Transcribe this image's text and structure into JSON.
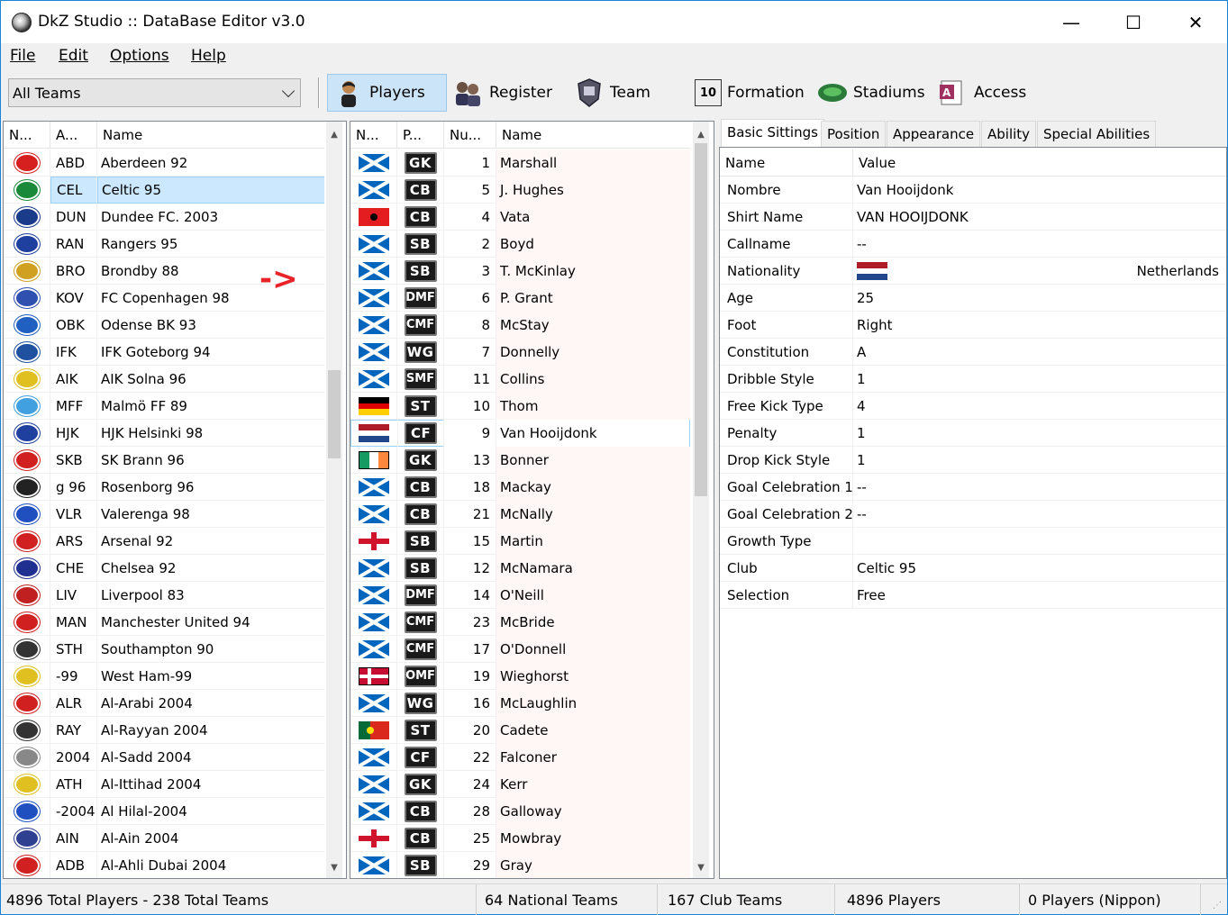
{
  "window": {
    "title": "DkZ Studio :: DataBase Editor v3.0",
    "min": "—",
    "max": "☐",
    "close": "✕"
  },
  "menu": [
    {
      "label": "File"
    },
    {
      "label": "Edit"
    },
    {
      "label": "Options"
    },
    {
      "label": "Help"
    }
  ],
  "team_filter": {
    "value": "All Teams"
  },
  "toolbar": {
    "players": "Players",
    "register": "Register",
    "team": "Team",
    "formation": "Formation",
    "stadiums": "Stadiums",
    "access": "Access"
  },
  "teams_table": {
    "headers": [
      "N...",
      "A...",
      "Name"
    ],
    "selected_index": 1,
    "rows": [
      {
        "abbr": "ABD",
        "name": "Aberdeen 92",
        "color": "#d62020"
      },
      {
        "abbr": "CEL",
        "name": "Celtic 95",
        "color": "#1a8a3a"
      },
      {
        "abbr": "DUN",
        "name": "Dundee FC. 2003",
        "color": "#1a3a8a"
      },
      {
        "abbr": "RAN",
        "name": "Rangers 95",
        "color": "#2040a0"
      },
      {
        "abbr": "BRO",
        "name": "Brondby 88",
        "color": "#d0a020"
      },
      {
        "abbr": "KOV",
        "name": "FC Copenhagen 98",
        "color": "#3050b0"
      },
      {
        "abbr": "OBK",
        "name": "Odense BK 93",
        "color": "#2060c0"
      },
      {
        "abbr": "IFK",
        "name": "IFK Goteborg 94",
        "color": "#2050a0"
      },
      {
        "abbr": "AIK",
        "name": "AIK Solna 96",
        "color": "#e0c020"
      },
      {
        "abbr": "MFF",
        "name": "Malmö FF 89",
        "color": "#40a0e0"
      },
      {
        "abbr": "HJK",
        "name": "HJK Helsinki 98",
        "color": "#2040a0"
      },
      {
        "abbr": "SKB",
        "name": "SK Brann 96",
        "color": "#d02020"
      },
      {
        "abbr": "g 96",
        "name": "Rosenborg 96",
        "color": "#222222"
      },
      {
        "abbr": "VLR",
        "name": "Valerenga 98",
        "color": "#2050c0"
      },
      {
        "abbr": "ARS",
        "name": "Arsenal 92",
        "color": "#d02020"
      },
      {
        "abbr": "CHE",
        "name": "Chelsea 92",
        "color": "#203090"
      },
      {
        "abbr": "LIV",
        "name": "Liverpool 83",
        "color": "#c02020"
      },
      {
        "abbr": "MAN",
        "name": "Manchester United 94",
        "color": "#d02020"
      },
      {
        "abbr": "STH",
        "name": "Southampton 90",
        "color": "#333333"
      },
      {
        "abbr": "-99",
        "name": "West Ham-99",
        "color": "#e0c020"
      },
      {
        "abbr": "ALR",
        "name": "Al-Arabi 2004",
        "color": "#d02020"
      },
      {
        "abbr": "RAY",
        "name": "Al-Rayyan 2004",
        "color": "#333333"
      },
      {
        "abbr": "2004",
        "name": "Al-Sadd 2004",
        "color": "#888888"
      },
      {
        "abbr": "ATH",
        "name": "Al-Ittihad 2004",
        "color": "#e0c020"
      },
      {
        "abbr": "-2004",
        "name": "Al Hilal-2004",
        "color": "#2050c0"
      },
      {
        "abbr": "AIN",
        "name": "Al-Ain 2004",
        "color": "#304090"
      },
      {
        "abbr": "ADB",
        "name": "Al-Ahli Dubai 2004",
        "color": "#d02020"
      }
    ]
  },
  "players_table": {
    "headers": [
      "N...",
      "P...",
      "Nu...",
      "Name"
    ],
    "selected_index": 10,
    "rows": [
      {
        "flag": "scotland",
        "pos": "GK",
        "num": "1",
        "name": "Marshall"
      },
      {
        "flag": "scotland",
        "pos": "CB",
        "num": "5",
        "name": "J. Hughes"
      },
      {
        "flag": "albania",
        "pos": "CB",
        "num": "4",
        "name": "Vata"
      },
      {
        "flag": "scotland",
        "pos": "SB",
        "num": "2",
        "name": "Boyd"
      },
      {
        "flag": "scotland",
        "pos": "SB",
        "num": "3",
        "name": "T. McKinlay"
      },
      {
        "flag": "scotland",
        "pos": "DMF",
        "num": "6",
        "name": "P. Grant"
      },
      {
        "flag": "scotland",
        "pos": "CMF",
        "num": "8",
        "name": "McStay"
      },
      {
        "flag": "scotland",
        "pos": "WG",
        "num": "7",
        "name": "Donnelly"
      },
      {
        "flag": "scotland",
        "pos": "SMF",
        "num": "11",
        "name": "Collins"
      },
      {
        "flag": "germany",
        "pos": "ST",
        "num": "10",
        "name": "Thom"
      },
      {
        "flag": "netherlands",
        "pos": "CF",
        "num": "9",
        "name": "Van Hooijdonk"
      },
      {
        "flag": "ireland",
        "pos": "GK",
        "num": "13",
        "name": "Bonner"
      },
      {
        "flag": "scotland",
        "pos": "CB",
        "num": "18",
        "name": "Mackay"
      },
      {
        "flag": "scotland",
        "pos": "CB",
        "num": "21",
        "name": "McNally"
      },
      {
        "flag": "england",
        "pos": "SB",
        "num": "15",
        "name": "Martin"
      },
      {
        "flag": "scotland",
        "pos": "SB",
        "num": "12",
        "name": "McNamara"
      },
      {
        "flag": "scotland",
        "pos": "DMF",
        "num": "14",
        "name": "O'Neill"
      },
      {
        "flag": "scotland",
        "pos": "CMF",
        "num": "23",
        "name": "McBride"
      },
      {
        "flag": "scotland",
        "pos": "CMF",
        "num": "17",
        "name": "O'Donnell"
      },
      {
        "flag": "denmark",
        "pos": "OMF",
        "num": "19",
        "name": "Wieghorst"
      },
      {
        "flag": "scotland",
        "pos": "WG",
        "num": "16",
        "name": "McLaughlin"
      },
      {
        "flag": "portugal",
        "pos": "ST",
        "num": "20",
        "name": "Cadete"
      },
      {
        "flag": "scotland",
        "pos": "CF",
        "num": "22",
        "name": "Falconer"
      },
      {
        "flag": "scotland",
        "pos": "GK",
        "num": "24",
        "name": "Kerr"
      },
      {
        "flag": "scotland",
        "pos": "CB",
        "num": "28",
        "name": "Galloway"
      },
      {
        "flag": "england",
        "pos": "CB",
        "num": "25",
        "name": "Mowbray"
      },
      {
        "flag": "scotland",
        "pos": "SB",
        "num": "29",
        "name": "Gray"
      }
    ]
  },
  "position_colors": {
    "GK": "#1a1a1a",
    "CB": "#1a1a1a",
    "SB": "#1a1a1a",
    "DMF": "#1a1a1a",
    "CMF": "#1a1a1a",
    "SMF": "#1a1a1a",
    "OMF": "#1a1a1a",
    "WG": "#1a1a1a",
    "ST": "#1a1a1a",
    "CF": "#1a1a1a"
  },
  "tabs": [
    {
      "label": "Basic Sittings"
    },
    {
      "label": "Position"
    },
    {
      "label": "Appearance"
    },
    {
      "label": "Ability"
    },
    {
      "label": "Special Abilities"
    }
  ],
  "props": {
    "headers": [
      "Name",
      "Value"
    ],
    "rows": [
      {
        "k": "Nombre",
        "v": "Van Hooijdonk"
      },
      {
        "k": "Shirt Name",
        "v": "VAN HOOIJDONK"
      },
      {
        "k": "Callname",
        "v": "--"
      },
      {
        "k": "Nationality",
        "v": "Netherlands",
        "flag": "netherlands"
      },
      {
        "k": "Age",
        "v": "25"
      },
      {
        "k": "Foot",
        "v": "Right"
      },
      {
        "k": "Constitution",
        "v": "A"
      },
      {
        "k": "Dribble Style",
        "v": "1"
      },
      {
        "k": "Free Kick Type",
        "v": "4"
      },
      {
        "k": "Penalty",
        "v": "1"
      },
      {
        "k": "Drop Kick Style",
        "v": "1"
      },
      {
        "k": "Goal Celebration 1",
        "v": "--"
      },
      {
        "k": "Goal Celebration 2",
        "v": "--"
      },
      {
        "k": "Growth Type",
        "v": ""
      },
      {
        "k": "Club",
        "v": "Celtic 95"
      },
      {
        "k": "Selection",
        "v": "Free"
      }
    ]
  },
  "annotation": "->",
  "status": {
    "total": "4896 Total Players  -  238 Total Teams",
    "national": "64 National Teams",
    "club": "167 Club Teams",
    "players": "4896 Players",
    "nippon": "0 Players (Nippon)"
  }
}
